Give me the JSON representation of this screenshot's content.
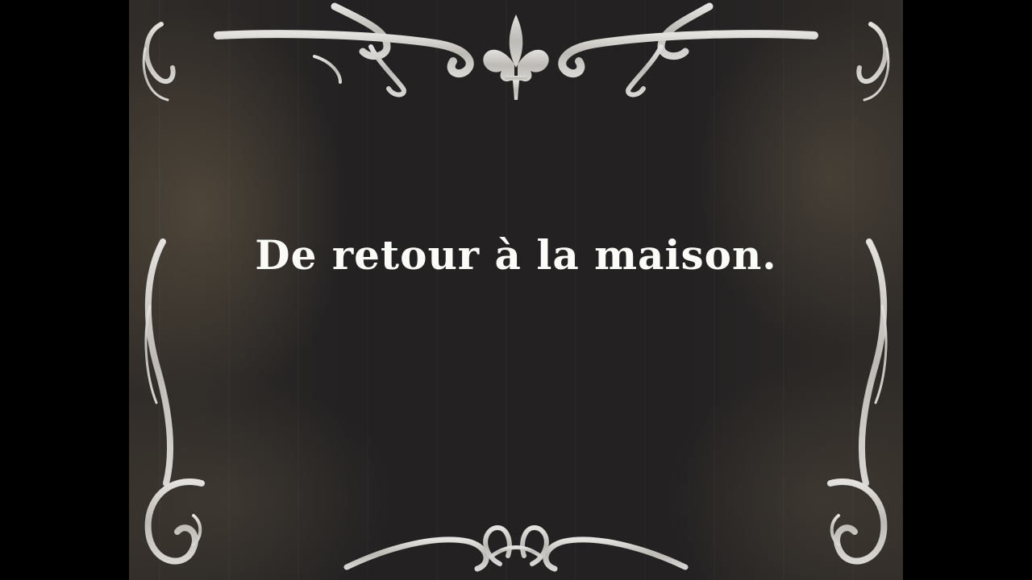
{
  "intertitle": {
    "text": "De retour à la maison."
  },
  "colors": {
    "background": "#000000",
    "card": "#232122",
    "ornament": "#cfcdc8",
    "text": "#fbfbf8"
  },
  "icons": [
    "fleur-de-lis-icon",
    "scroll-flourish-icon"
  ]
}
